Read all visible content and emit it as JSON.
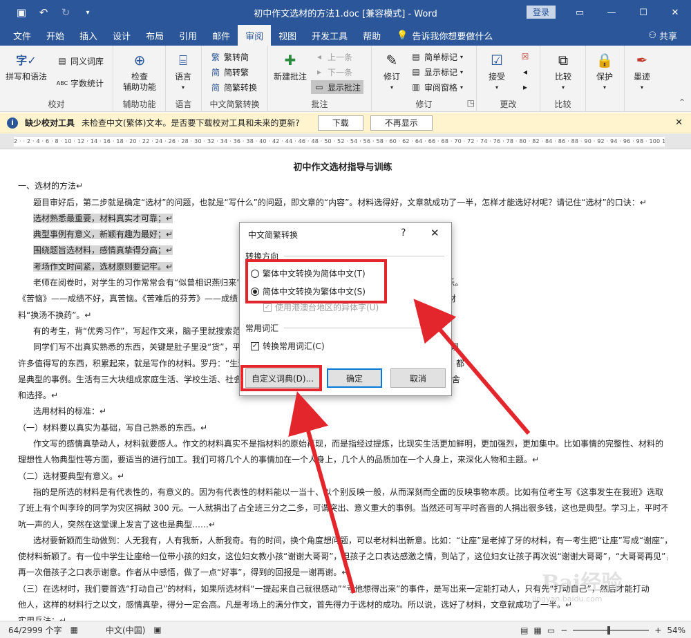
{
  "titlebar": {
    "doc_title": "初中作文选材的方法1.doc [兼容模式] - Word",
    "login": "登录",
    "qat": [
      "save-icon",
      "undo-icon",
      "redo-icon",
      "customize-icon"
    ]
  },
  "tabs": [
    "文件",
    "开始",
    "插入",
    "设计",
    "布局",
    "引用",
    "邮件",
    "审阅",
    "视图",
    "开发工具",
    "帮助"
  ],
  "active_tab": "审阅",
  "tell_me": "告诉我你想要做什么",
  "share": "共享",
  "ribbon": {
    "proofing": {
      "label": "校对",
      "spelling": "拼写和语法",
      "thesaurus": "同义词库",
      "wordcount": "字数统计"
    },
    "accessibility": {
      "label": "辅助功能",
      "check": "检查\n辅助功能"
    },
    "language": {
      "label": "语言",
      "btn": "语言"
    },
    "chinese_conv": {
      "label": "中文简繁转换",
      "to_simp": "繁转简",
      "to_trad": "简转繁",
      "conv": "简繁转换"
    },
    "comments": {
      "label": "批注",
      "new": "新建批注",
      "prev": "上一条",
      "next": "下一条",
      "show": "显示批注"
    },
    "tracking": {
      "label": "修订",
      "track": "修订",
      "simple_markup": "简单标记",
      "show_markup": "显示标记",
      "review_pane": "审阅窗格"
    },
    "changes": {
      "label": "更改",
      "accept": "接受"
    },
    "compare": {
      "label": "比较",
      "btn": "比较"
    },
    "protect": {
      "btn": "保护"
    },
    "ink": {
      "btn": "墨迹"
    }
  },
  "msgbar": {
    "title": "缺少校对工具",
    "text": "未检查中文(繁体)文本。是否要下载校对工具和未来的更新?",
    "download": "下载",
    "dismiss": "不再显示"
  },
  "ruler": "2 · · 2 · 4 · 6 · 8 · 10 · 12 · 14 · 16 · 18 · 20 · 22 · 24 · 26 · 28 · 30 · 32 · 34 · 36 · 38 · 40 · 42 · 44 · 46 · 48 · 50 · 52 · 54 · 56 · 58 · 60 · 62 · 64 · 66 · 68 · 70 · 72 · 74 · 76 · 78 · 80 · 82 · 84 · 86 · 88 · 90 · 92 · 94 · 96 · 98 · 100 102 104 106 108 110 112 114 116 118 · 122",
  "document": {
    "title": "初中作文选材指导与训练",
    "lines": [
      {
        "style": "plain",
        "text": "一、选材的方法↵"
      },
      {
        "style": "indent",
        "text": "题目审好后，第二步就是确定“选材”的问题，也就是“写什么”的问题，即文章的“内容”。材料选得好，文章就成功了一半，怎样才能选好材呢？请记住“选材”的口诀：↵"
      },
      {
        "style": "hl",
        "text": "选材熟悉最重要，材料真实才可靠；↵"
      },
      {
        "style": "hl",
        "text": "典型事例有意义，新颖有趣为最好；↵"
      },
      {
        "style": "hl",
        "text": "围绕题旨选材料，感情真挚得分高；↵"
      },
      {
        "style": "hl",
        "text": "考场作文时间紧，选材原则要记牢。↵"
      },
      {
        "style": "indent",
        "text": "老师在阅卷时，对学生的习作常常会有“似曾相识燕归来”                                                      ——终于获奖了。《快乐》——获奖了，考好了，非常快乐。"
      },
      {
        "style": "plain",
        "text": "《苦恼》——成绩不好，真苦恼。《苦难后的芬芳》——成绩                                                                  获奖的一次经历。……许多考生，选材没有新意，就一个材"
      },
      {
        "style": "plain",
        "text": "料“换汤不换药”。↵"
      },
      {
        "style": "indent",
        "text": "有的考生，背“优秀习作”，写起作文来，脑子里就搜索范                                                     作文没有真情实感，自然不能得高分。↵"
      },
      {
        "style": "indent",
        "text": "同学们写不出真实熟悉的东西，关键是肚子里没“货”，平                                                     是要你做生活的有的人，留意生活，在生活中你一定会发现"
      },
      {
        "style": "plain",
        "text": "许多值得写的东西，积累起来，就是写作的材料。罗丹：“生活                                                      篇，是百科全书。生活中的许多闪光点，都具有典型性，都"
      },
      {
        "style": "plain",
        "text": "是典型的事例。生活有三大块组成家庭生活、学校生活、社会                                                          映。然而作文不是材料的堆积，因此我们要注意材料的取舍"
      },
      {
        "style": "plain",
        "text": "和选择。↵"
      },
      {
        "style": "indent",
        "text": "选用材料的标准：↵"
      },
      {
        "style": "plain",
        "text": "  （一）材料要以真实为基础，写自己熟悉的东西。↵"
      },
      {
        "style": "indent",
        "text": "作文写的感情真挚动人，材料就要感人。作文的材料真实不是指材料的原始再现，而是指经过提炼，比现实生活更加鲜明，更加强烈，更加集中。比如事情的完整性、材料的"
      },
      {
        "style": "plain",
        "text": "理想性人物典型性等方面，要适当的进行加工。我们可将几个人的事情加在一个人身上，几个人的品质加在一个人身上，来深化人物和主题。↵"
      },
      {
        "style": "plain",
        "text": "  （二）选材要典型有意义。↵"
      },
      {
        "style": "indent",
        "text": "指的是所选的材料是有代表性的，有意义的。因为有代表性的材料能以一当十、以个别反映一般，从而深刻而全面的反映事物本质。比如有位考生写《这事发生在我班》选取"
      },
      {
        "style": "plain",
        "text": "了班上有个叫李玲的同学为灾区捐献 300 元。一人就捐出了占全班三分之二多，可谓突出、意义重大的事例。当然还可写平时吝啬的人捐出很多钱，这也是典型。学习上，平时不"
      },
      {
        "style": "plain",
        "text": "吭一声的人，突然在这堂课上发言了这也是典型……↵"
      },
      {
        "style": "indent",
        "text": "选材要新颖而生动做到：人无我有，人有我新，人新我奇。有的时间，换个角度想问题，可以老材料出新意。比如：“让座”是老掉了牙的材料，有一考生把“让座”写成“谢座”，"
      },
      {
        "style": "plain",
        "text": "使材料新颖了。有一位中学生让座给一位带小孩的妇女，这位妇女教小孩“谢谢大哥哥”，但孩子之口表达感激之情，到站了，这位妇女让孩子再次说“谢谢大哥哥”，“大哥哥再见”，"
      },
      {
        "style": "plain",
        "text": "再一次借孩子之口表示谢意。作者从中感悟，做了一点“好事”，得到的回报是一谢再谢。↵"
      },
      {
        "style": "plain",
        "text": "  （三）在选材时，我们要首选“打动自己”的材料，如果所选材料“一提起来自己就很感动”“亏他想得出来”的事件，是写出来一定能打动人，只有先“打动自己”，然后才能打动"
      },
      {
        "style": "plain",
        "text": "他人，这样的材料行之以文，感情真挚，得分一定会高。凡是考场上的满分作文，首先得力于选材的成功。所以说，选好了材料，文章就成功了一半。↵"
      },
      {
        "style": "plain",
        "text": "实用兵法：↵"
      }
    ]
  },
  "dialog": {
    "title": "中文简繁转换",
    "help": "?",
    "direction_label": "转换方向",
    "opt_trad_to_simp": "繁体中文转换为简体中文(T)",
    "opt_simp_to_trad": "简体中文转换为繁体中文(S)",
    "selected": "simp_to_trad",
    "use_hk": "使用港澳台地区的异体字(U)",
    "vocab_label": "常用词汇",
    "convert_common": "转换常用词汇(C)",
    "custom_dict": "自定义词典(D)...",
    "ok": "确定",
    "cancel": "取消"
  },
  "status": {
    "page_word": "64/2999 个字",
    "language": "中文(中国)",
    "zoom": "54%"
  },
  "watermark": {
    "text": "jingyan.baidu.com"
  },
  "colors": {
    "word_blue": "#2b579a",
    "highlight_red": "#e3262b",
    "msgbar": "#fff4ce"
  }
}
